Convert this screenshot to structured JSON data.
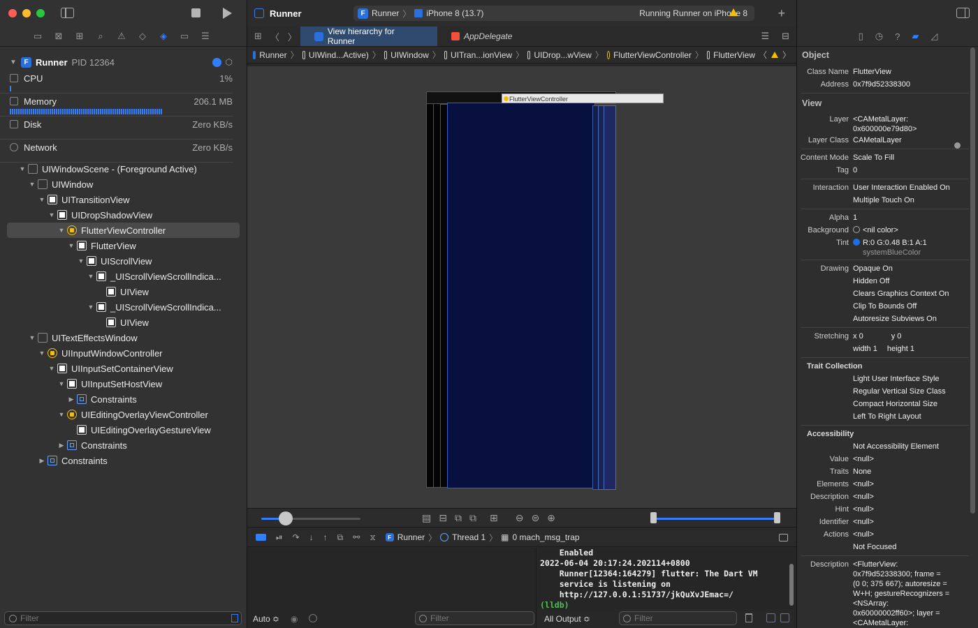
{
  "navigator": {
    "process": {
      "name": "Runner",
      "pid": "PID 12364"
    },
    "gauges": [
      {
        "label": "CPU",
        "value": "1%"
      },
      {
        "label": "Memory",
        "value": "206.1 MB"
      },
      {
        "label": "Disk",
        "value": "Zero KB/s"
      },
      {
        "label": "Network",
        "value": "Zero KB/s"
      }
    ],
    "tree": [
      {
        "label": "UIWindowScene - (Foreground Active)",
        "depth": 1,
        "chev": "open",
        "icon": "scene"
      },
      {
        "label": "UIWindow",
        "depth": 2,
        "chev": "open",
        "icon": "empty"
      },
      {
        "label": "UITransitionView",
        "depth": 3,
        "chev": "open",
        "icon": "filled"
      },
      {
        "label": "UIDropShadowView",
        "depth": 4,
        "chev": "open",
        "icon": "filled"
      },
      {
        "label": "FlutterViewController",
        "depth": 5,
        "chev": "open",
        "icon": "vc",
        "selected": true
      },
      {
        "label": "FlutterView",
        "depth": 6,
        "chev": "open",
        "icon": "filled"
      },
      {
        "label": "UIScrollView",
        "depth": 7,
        "chev": "open",
        "icon": "filled"
      },
      {
        "label": "_UIScrollViewScrollIndica...",
        "depth": 8,
        "chev": "open",
        "icon": "filled"
      },
      {
        "label": "UIView",
        "depth": 9,
        "chev": "none",
        "icon": "filled"
      },
      {
        "label": "_UIScrollViewScrollIndica...",
        "depth": 8,
        "chev": "open",
        "icon": "filled"
      },
      {
        "label": "UIView",
        "depth": 9,
        "chev": "none",
        "icon": "filled"
      },
      {
        "label": "UITextEffectsWindow",
        "depth": 2,
        "chev": "open",
        "icon": "empty"
      },
      {
        "label": "UIInputWindowController",
        "depth": 3,
        "chev": "open",
        "icon": "vc"
      },
      {
        "label": "UIInputSetContainerView",
        "depth": 4,
        "chev": "open",
        "icon": "filled"
      },
      {
        "label": "UIInputSetHostView",
        "depth": 5,
        "chev": "open",
        "icon": "filled"
      },
      {
        "label": "Constraints",
        "depth": 6,
        "chev": "closed",
        "icon": "con"
      },
      {
        "label": "UIEditingOverlayViewController",
        "depth": 5,
        "chev": "open",
        "icon": "vc"
      },
      {
        "label": "UIEditingOverlayGestureView",
        "depth": 6,
        "chev": "none",
        "icon": "filled"
      },
      {
        "label": "Constraints",
        "depth": 5,
        "chev": "closed",
        "icon": "con"
      },
      {
        "label": "Constraints",
        "depth": 3,
        "chev": "closed",
        "icon": "con"
      }
    ],
    "filter_placeholder": "Filter"
  },
  "toolbar": {
    "project": "Runner",
    "scheme": "Runner",
    "device": "iPhone 8 (13.7)",
    "status": "Running Runner on iPhone 8"
  },
  "tabs": [
    {
      "label": "View hierarchy for Runner",
      "active": true
    },
    {
      "label": "AppDelegate",
      "active": false
    }
  ],
  "jumpbar": [
    "Runner",
    "UIWind...Active)",
    "UIWindow",
    "UITran...ionView",
    "UIDrop...wView",
    "FlutterViewController",
    "FlutterView"
  ],
  "canvas": {
    "vc_label": "FlutterViewController",
    "zoom_slider": 0.25
  },
  "debug_bar": {
    "process": "Runner",
    "thread": "Thread 1",
    "frame": "0 mach_msg_trap"
  },
  "console": {
    "lines": [
      "    Enabled",
      "2022-06-04 20:17:24.202114+0800",
      "    Runner[12364:164279] flutter: The Dart VM",
      "    service is listening on",
      "    http://127.0.0.1:51737/jkQuXvJEmac=/"
    ],
    "prompt": "(lldb)"
  },
  "bottom": {
    "auto_label": "Auto ≎",
    "output_label": "All Output ≎",
    "filter_placeholder": "Filter"
  },
  "inspector": {
    "object_header": "Object",
    "object_rows": [
      {
        "k": "Class Name",
        "v": "FlutterView"
      },
      {
        "k": "Address",
        "v": "0x7f9d52338300"
      }
    ],
    "view_header": "View",
    "view_rows_1": [
      {
        "k": "Layer",
        "v": "<CAMetalLayer:\n0x600000e79d80>"
      },
      {
        "k": "Layer Class",
        "v": "CAMetalLayer"
      }
    ],
    "view_rows_2": [
      {
        "k": "Content Mode",
        "v": "Scale To Fill"
      },
      {
        "k": "Tag",
        "v": "0"
      }
    ],
    "view_rows_3": [
      {
        "k": "Interaction",
        "v": "User Interaction Enabled On"
      },
      {
        "k": "",
        "v": "Multiple Touch On"
      }
    ],
    "alpha": {
      "k": "Alpha",
      "v": "1"
    },
    "background": {
      "k": "Background",
      "v": "<nil color>"
    },
    "tint": {
      "k": "Tint",
      "v": "R:0 G:0.48 B:1 A:1",
      "sub": "systemBlueColor",
      "color": "#1a6fe6"
    },
    "drawing_rows": [
      {
        "k": "Drawing",
        "v": "Opaque On"
      },
      {
        "k": "",
        "v": "Hidden Off"
      },
      {
        "k": "",
        "v": "Clears Graphics Context On"
      },
      {
        "k": "",
        "v": "Clip To Bounds Off"
      },
      {
        "k": "",
        "v": "Autoresize Subviews On"
      }
    ],
    "stretching": {
      "k": "Stretching",
      "x_label": "x",
      "x": "0",
      "y_label": "y",
      "y": "0",
      "w_label": "width",
      "w": "1",
      "h_label": "height",
      "h": "1"
    },
    "trait_header": "Trait Collection",
    "trait_rows": [
      "Light User Interface Style",
      "Regular Vertical Size Class",
      "Compact Horizontal Size",
      "Left To Right Layout"
    ],
    "access_header": "Accessibility",
    "access_rows": [
      {
        "k": "",
        "v": "Not Accessibility Element"
      },
      {
        "k": "Value",
        "v": "<null>"
      },
      {
        "k": "Traits",
        "v": "None"
      },
      {
        "k": "Elements",
        "v": "<null>"
      },
      {
        "k": "Description",
        "v": "<null>"
      },
      {
        "k": "Hint",
        "v": "<null>"
      },
      {
        "k": "Identifier",
        "v": "<null>"
      },
      {
        "k": "Actions",
        "v": "<null>"
      },
      {
        "k": "",
        "v": "Not Focused"
      }
    ],
    "description": {
      "k": "Description",
      "v": "<FlutterView:\n0x7f9d52338300; frame =\n(0 0; 375 667); autoresize =\nW+H; gestureRecognizers =\n<NSArray:\n0x60000002ff60>; layer =\n<CAMetalLayer:"
    }
  }
}
